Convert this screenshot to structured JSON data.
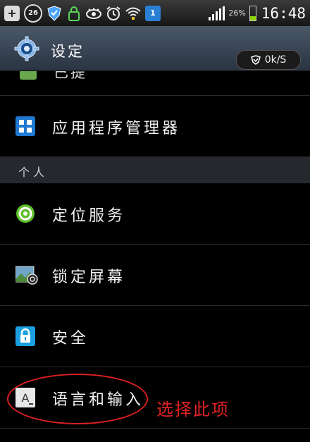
{
  "status_bar": {
    "notification_badge": "26",
    "battery_percent": "26%",
    "battery_level": 0.26,
    "time": "16:48",
    "icons": [
      "plus-icon",
      "notification-count-icon",
      "shield-icon",
      "lock-icon",
      "eye-icon",
      "alarm-icon",
      "wifi-icon",
      "download-icon",
      "signal-icon",
      "battery-icon"
    ]
  },
  "action_bar": {
    "title": "设定",
    "net_speed": "0k/S"
  },
  "list": {
    "partial_item_label": "已提",
    "items": [
      {
        "label": "应用程序管理器",
        "icon": "apps-grid-icon"
      },
      {
        "label": "定位服务",
        "icon": "location-icon"
      },
      {
        "label": "锁定屏幕",
        "icon": "lock-screen-icon"
      },
      {
        "label": "安全",
        "icon": "padlock-icon"
      },
      {
        "label": "语言和输入",
        "icon": "language-input-icon"
      }
    ],
    "section_header": "个人"
  },
  "annotation": {
    "text": "选择此项",
    "color": "#e22222"
  }
}
